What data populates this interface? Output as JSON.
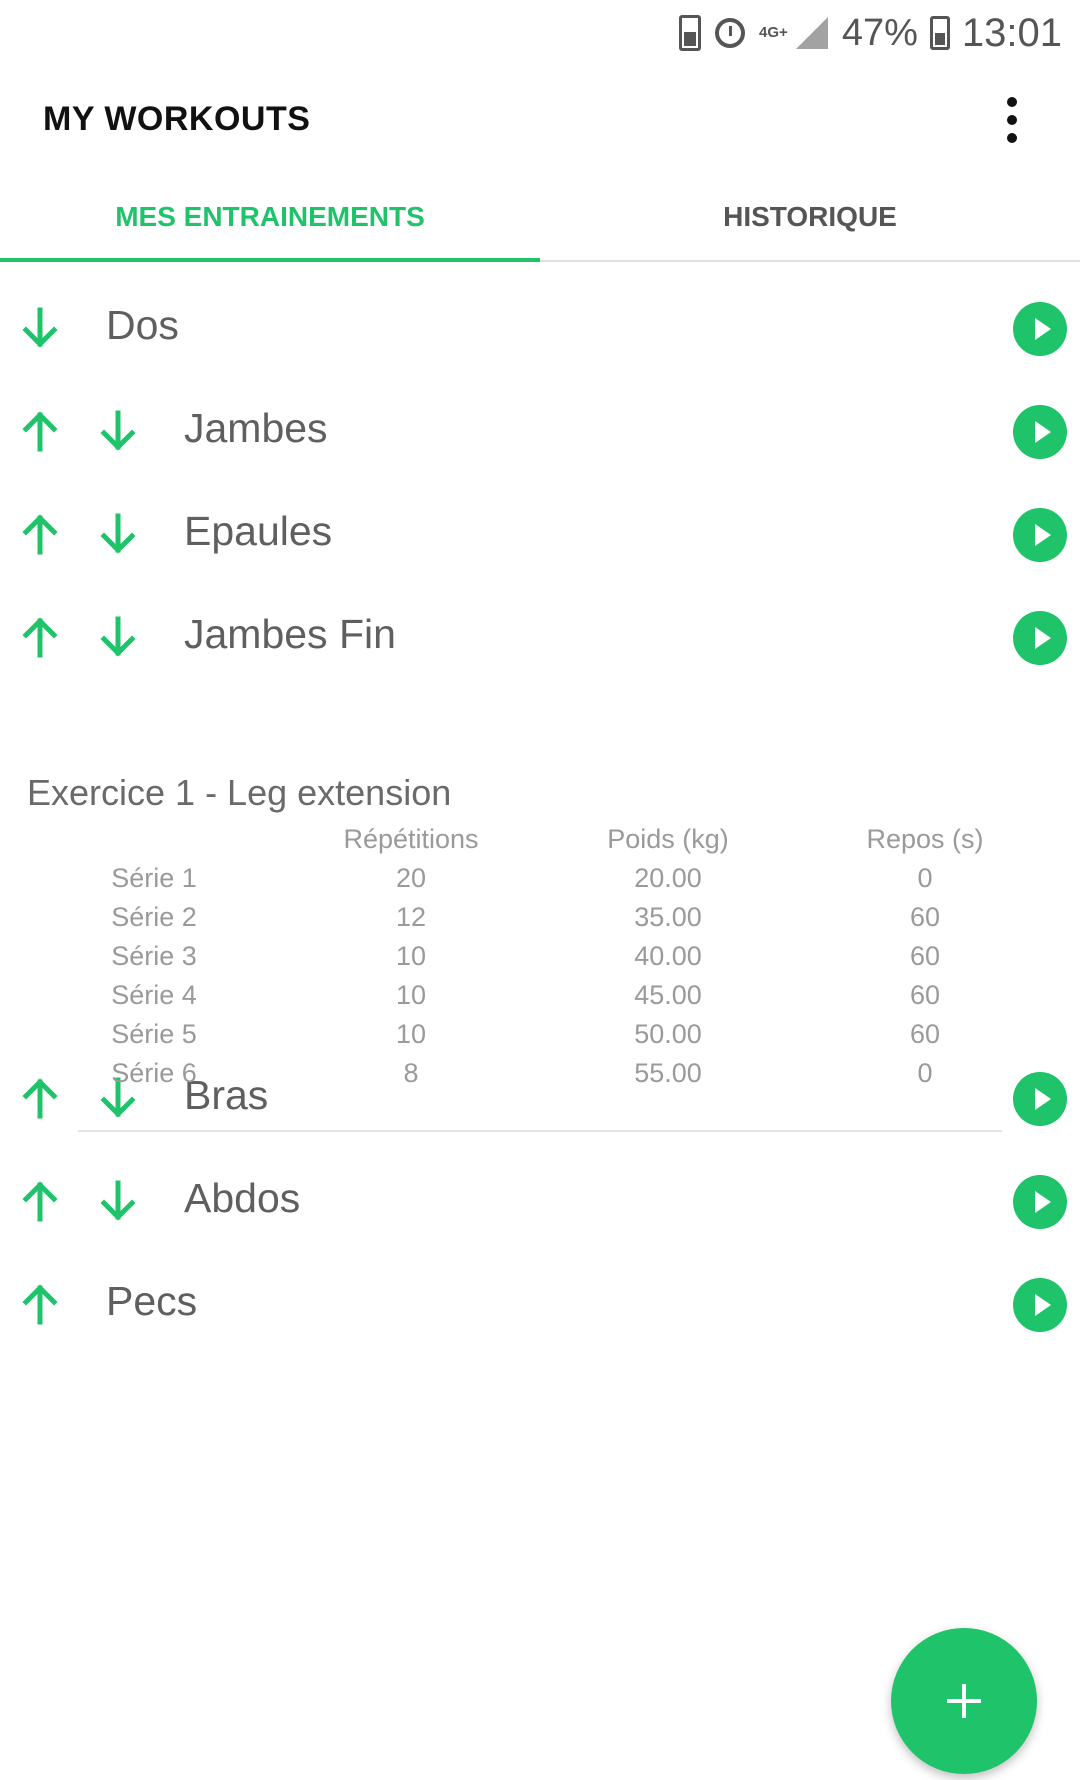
{
  "status_bar": {
    "network": "4G+",
    "battery_pct": "47%",
    "time": "13:01"
  },
  "app_bar": {
    "title": "MY WORKOUTS"
  },
  "tabs": [
    {
      "label": "MES ENTRAINEMENTS",
      "active": true
    },
    {
      "label": "HISTORIQUE",
      "active": false
    }
  ],
  "workouts": [
    {
      "name": "Dos",
      "up": false,
      "down": true
    },
    {
      "name": "Jambes",
      "up": true,
      "down": true
    },
    {
      "name": "Epaules",
      "up": true,
      "down": true
    },
    {
      "name": "Jambes Fin",
      "up": true,
      "down": true
    },
    {
      "name": "Bras",
      "up": true,
      "down": true
    },
    {
      "name": "Abdos",
      "up": true,
      "down": true
    },
    {
      "name": "Pecs",
      "up": true,
      "down": false
    }
  ],
  "exercise": {
    "title": "Exercice 1 - Leg extension",
    "headers": [
      "Répétitions",
      "Poids (kg)",
      "Repos (s)"
    ],
    "rows": [
      {
        "serie": "Série 1",
        "reps": "20",
        "poids": "20.00",
        "repos": "0"
      },
      {
        "serie": "Série 2",
        "reps": "12",
        "poids": "35.00",
        "repos": "60"
      },
      {
        "serie": "Série 3",
        "reps": "10",
        "poids": "40.00",
        "repos": "60"
      },
      {
        "serie": "Série 4",
        "reps": "10",
        "poids": "45.00",
        "repos": "60"
      },
      {
        "serie": "Série 5",
        "reps": "10",
        "poids": "50.00",
        "repos": "60"
      },
      {
        "serie": "Série 6",
        "reps": "8",
        "poids": "55.00",
        "repos": "0"
      }
    ]
  },
  "colors": {
    "accent": "#1fc36a",
    "text_primary": "#5f5f5f",
    "text_secondary": "#9a9a9a"
  }
}
